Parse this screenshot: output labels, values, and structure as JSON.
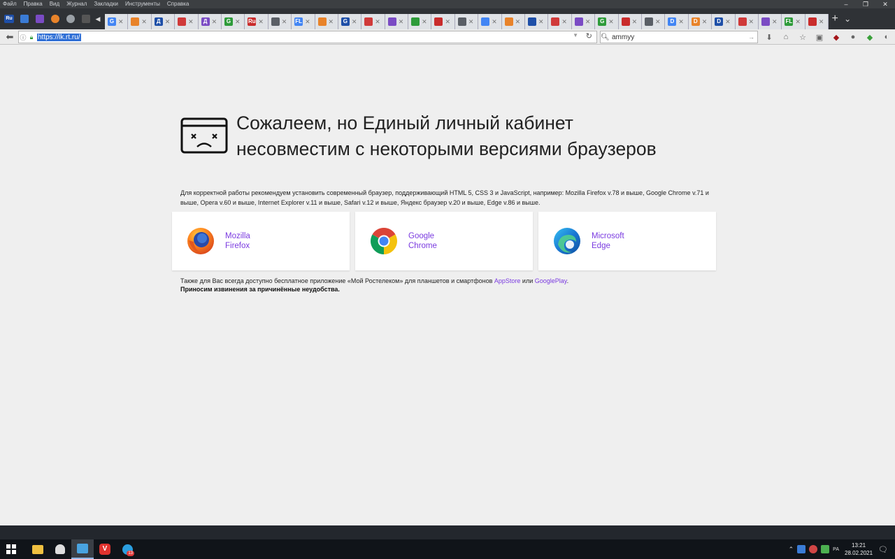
{
  "menu": {
    "items": [
      "Файл",
      "Правка",
      "Вид",
      "Журнал",
      "Закладки",
      "Инструменты",
      "Справка"
    ]
  },
  "window_controls": {
    "minimize": "–",
    "restore": "❐",
    "close": "✕"
  },
  "tabstrip": {
    "pinned_icons": [
      "ru-logo-icon",
      "chat-icon",
      "purple-app-icon",
      "orange-app-icon",
      "globe-icon",
      "dark-app-icon"
    ],
    "tab_favicon_letters": [
      "G",
      "",
      "Д",
      "",
      "Д",
      "G",
      "Ru",
      "",
      "FL",
      "",
      "G",
      "",
      "",
      "",
      "",
      "",
      "",
      "",
      "",
      "",
      "",
      "G",
      "",
      "",
      "D",
      "D",
      "D",
      "",
      "",
      "FL",
      ""
    ],
    "new_tab_label": "+",
    "tab_menu_label": "⌄"
  },
  "address": {
    "url": "https://lk.rt.ru/",
    "search_value": "ammyy"
  },
  "page": {
    "headline_line1": "Сожалеем, но Единый личный кабинет",
    "headline_line2": "несовместим с некоторыми версиями браузеров",
    "recommend_text": "Для корректной работы рекомендуем установить современный браузер, поддерживающий HTML 5, CSS 3 и JavaScript, например: Mozilla Firefox v.78 и выше, Google Chrome v.71 и выше, Opera v.60 и выше, Internet Explorer v.11 и выше, Safari v.12 и выше, Яндекс браузер v.20 и выше, Edge v.86 и выше.",
    "browsers": [
      {
        "name_line1": "Mozilla",
        "name_line2": "Firefox",
        "icon": "firefox-icon"
      },
      {
        "name_line1": "Google",
        "name_line2": "Chrome",
        "icon": "chrome-icon"
      },
      {
        "name_line1": "Microsoft",
        "name_line2": "Edge",
        "icon": "edge-icon"
      }
    ],
    "also_prefix": "Также для Вас всегда доступно бесплатное приложение «Мой Ростелеком» для планшетов и смартфонов ",
    "appstore_link": "AppStore",
    "or_text": " или ",
    "googleplay_link": "GooglePlay",
    "also_suffix": ".",
    "apology": "Приносим извинения за причинённые неудобства."
  },
  "taskbar": {
    "apps": [
      "file-explorer-icon",
      "fox-app-icon",
      "paint-app-icon",
      "vivaldi-icon",
      "telegram-icon"
    ],
    "telegram_badge": "13",
    "time": "13:21",
    "date": "28.02.2021",
    "tray_lang": "РА"
  },
  "colors": {
    "link_purple": "#7a3ae0",
    "page_bg": "#efefef",
    "taskbar_bg": "#101419",
    "url_selection": "#2f6fd6"
  }
}
